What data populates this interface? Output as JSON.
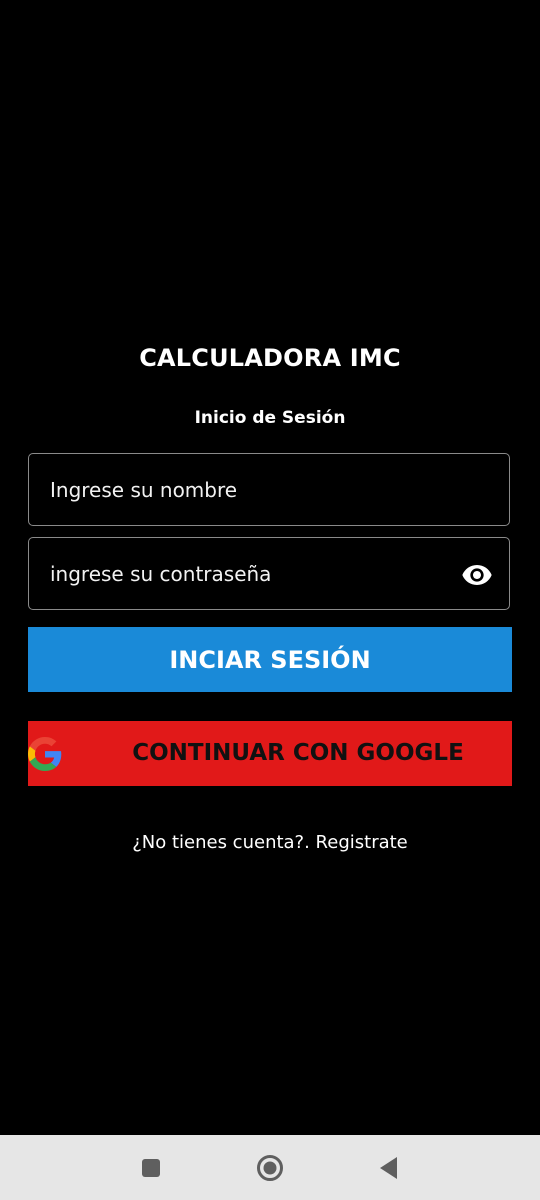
{
  "app": {
    "title": "CALCULADORA IMC",
    "subtitle": "Inicio de Sesión"
  },
  "form": {
    "username": {
      "placeholder": "Ingrese su nombre",
      "value": ""
    },
    "password": {
      "placeholder": "ingrese su contraseña",
      "value": "",
      "toggle_icon": "eye-icon"
    },
    "login_button_label": "INCIAR SESIÓN",
    "google_button_label": "CONTINUAR CON GOOGLE",
    "google_icon": "google-logo-icon",
    "register_link": "¿No tienes cuenta?. Registrate"
  },
  "colors": {
    "background": "#000000",
    "login_button": "#1a8ad8",
    "google_button": "#e11919",
    "navbar": "#e6e6e6"
  },
  "navbar": {
    "icons": [
      "recent-apps-icon",
      "home-icon",
      "back-icon"
    ]
  }
}
